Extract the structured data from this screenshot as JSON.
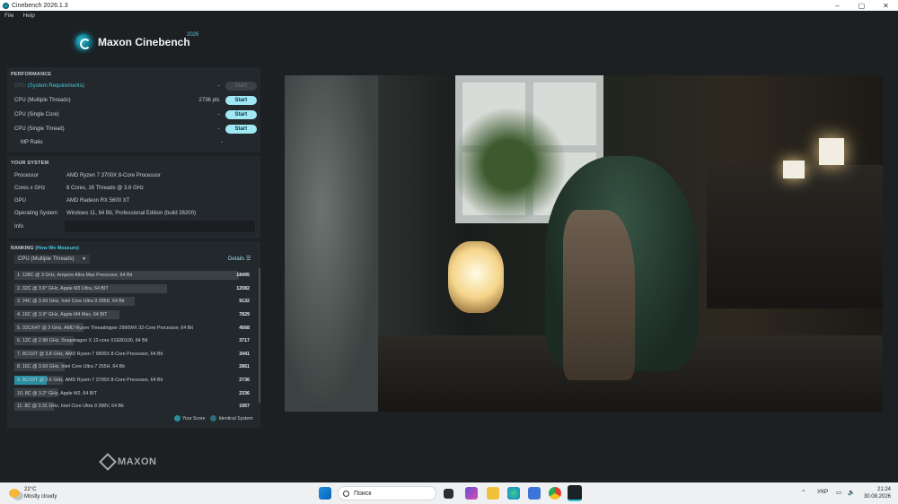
{
  "window": {
    "title": "Cinebench 2026.1.3",
    "minimize": "–",
    "maximize": "▢",
    "close": "✕"
  },
  "menu": [
    "File",
    "Help"
  ],
  "brand": {
    "name": "Maxon Cinebench",
    "year": "2026",
    "footer": "MAXON"
  },
  "performance": {
    "heading": "PERFORMANCE",
    "rows": [
      {
        "label": "GPU",
        "link": "(System Requirements)",
        "value": "-",
        "button": "Start",
        "enabled": false
      },
      {
        "label": "CPU (Multiple Threads)",
        "value": "2736 pts",
        "button": "Start",
        "enabled": true
      },
      {
        "label": "CPU (Single Core)",
        "value": "-",
        "button": "Start",
        "enabled": true
      },
      {
        "label": "CPU (Single Thread)",
        "value": "-",
        "button": "Start",
        "enabled": true
      },
      {
        "label": "MP Ratio",
        "value": "-"
      }
    ]
  },
  "system": {
    "heading": "YOUR SYSTEM",
    "rows": [
      {
        "key": "Processor",
        "value": "AMD Ryzen 7 3700X 8-Core Processor"
      },
      {
        "key": "Cores x GHz",
        "value": "8 Cores, 16 Threads @ 3.6 GHz"
      },
      {
        "key": "GPU",
        "value": "AMD Radeon RX 5600 XT"
      },
      {
        "key": "Operating System",
        "value": "Windows 11, 64 Bit, Professional Edition (build 26200)"
      },
      {
        "key": "Info",
        "value": ""
      }
    ]
  },
  "ranking": {
    "heading": "RANKING",
    "link": "(How We Measure)",
    "dropdown": "CPU (Multiple Threads)",
    "details": "Details",
    "max": 18495,
    "rows": [
      {
        "name": "1. 128C @ 3 GHz, Ampere Altra Max Processor, 64 Bit",
        "score": "18495",
        "value": 18495
      },
      {
        "name": "2. 32C @ 3.6* GHz, Apple M3 Ultra, 64 BIT",
        "score": "12082",
        "value": 12082
      },
      {
        "name": "3. 24C @ 3.69 GHz, Intel Core Ultra 9 285K, 64 Bit",
        "score": "9132",
        "value": 9132
      },
      {
        "name": "4. 16C @ 3.9* GHz, Apple M4 Max, 64 BIT",
        "score": "7829",
        "value": 7829
      },
      {
        "name": "5. 32C/64T @ 3 GHz, AMD Ryzen Threadripper 2990WX 32-Core Processor, 64 Bit",
        "score": "4568",
        "value": 4568
      },
      {
        "name": "6. 12C @ 2.98 GHz, Snapdragon X 12-core X1E80100, 64 Bit",
        "score": "3717",
        "value": 3717
      },
      {
        "name": "7. 8C/16T @ 3.8 GHz, AMD Ryzen 7 5800X 8-Core Processor, 64 Bit",
        "score": "3441",
        "value": 3441
      },
      {
        "name": "8. 16C @ 3.69 GHz, Intel Core Ultra 7 255H, 64 Bit",
        "score": "2861",
        "value": 2861
      },
      {
        "name": "9. 8C/16T @ 3.6 GHz, AMD Ryzen 7 3700X 8-Core Processor, 64 Bit",
        "score": "2736",
        "value": 2736,
        "mine": true
      },
      {
        "name": "10. 8C @ 3.2* GHz, Apple M2, 64 BIT",
        "score": "2336",
        "value": 2336
      },
      {
        "name": "11. 8C @ 3.31 GHz, Intel Core Ultra 9 288V, 64 Bit",
        "score": "1957",
        "value": 1957
      }
    ],
    "legend": {
      "your_score": "Your Score",
      "identical": "Identical System",
      "your_color": "#2a8ea0",
      "identical_color": "#2a6c78"
    }
  },
  "taskbar": {
    "weather_temp": "22°C",
    "weather_desc": "Mostly cloudy",
    "search_placeholder": "Поиск",
    "lang": "УКР",
    "time": "21:24",
    "date": "30.08.2026",
    "icons": [
      "windows-start-icon",
      "task-view-icon",
      "widgets-icon",
      "file-explorer-icon",
      "edge-icon",
      "store-icon",
      "chrome-icon",
      "cinebench-icon"
    ]
  },
  "colors": {
    "accent": "#49c7de",
    "start_button": "#9fe8f4",
    "panel": "#23282c",
    "background": "#1c2023"
  }
}
